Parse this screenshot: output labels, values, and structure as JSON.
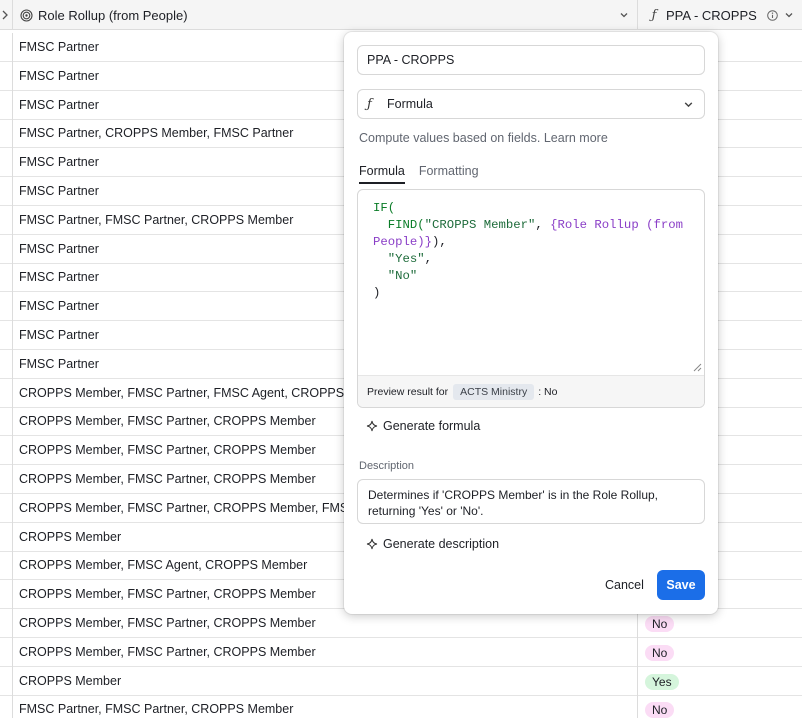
{
  "grid": {
    "columns": [
      {
        "label": "Role Rollup (from People)",
        "icon": "rollup-icon"
      },
      {
        "label": "PPA - CROPPS",
        "icon": "formula-icon"
      }
    ],
    "rows": [
      {
        "role": "FMSC Partner",
        "ppa": ""
      },
      {
        "role": "FMSC Partner",
        "ppa": ""
      },
      {
        "role": "FMSC Partner",
        "ppa": ""
      },
      {
        "role": "FMSC Partner, CROPPS Member, FMSC Partner",
        "ppa": ""
      },
      {
        "role": "FMSC Partner",
        "ppa": ""
      },
      {
        "role": "FMSC Partner",
        "ppa": ""
      },
      {
        "role": "FMSC Partner, FMSC Partner, CROPPS Member",
        "ppa": ""
      },
      {
        "role": "FMSC Partner",
        "ppa": ""
      },
      {
        "role": "FMSC Partner",
        "ppa": ""
      },
      {
        "role": "FMSC Partner",
        "ppa": ""
      },
      {
        "role": "FMSC Partner",
        "ppa": ""
      },
      {
        "role": "FMSC Partner",
        "ppa": ""
      },
      {
        "role": "CROPPS Member, FMSC Partner, FMSC Agent, CROPPS Member",
        "ppa": ""
      },
      {
        "role": "CROPPS Member, FMSC Partner, CROPPS Member",
        "ppa": ""
      },
      {
        "role": "CROPPS Member, FMSC Partner, CROPPS Member",
        "ppa": ""
      },
      {
        "role": "CROPPS Member, FMSC Partner, CROPPS Member",
        "ppa": ""
      },
      {
        "role": "CROPPS Member, FMSC Partner, CROPPS Member, FMSC Agent",
        "ppa": ""
      },
      {
        "role": "CROPPS Member",
        "ppa": ""
      },
      {
        "role": "CROPPS Member, FMSC Agent, CROPPS Member",
        "ppa": ""
      },
      {
        "role": "CROPPS Member, FMSC Partner, CROPPS Member",
        "ppa": ""
      },
      {
        "role": "CROPPS Member, FMSC Partner, CROPPS Member",
        "ppa": "No"
      },
      {
        "role": "CROPPS Member, FMSC Partner, CROPPS Member",
        "ppa": "No"
      },
      {
        "role": "CROPPS Member",
        "ppa": "Yes"
      },
      {
        "role": "FMSC Partner, FMSC Partner, CROPPS Member",
        "ppa": "No"
      }
    ]
  },
  "popover": {
    "field_name": "PPA - CROPPS",
    "field_type": "Formula",
    "helper_text": "Compute values based on fields.",
    "learn_more": "Learn more",
    "tabs": [
      {
        "label": "Formula",
        "active": true
      },
      {
        "label": "Formatting",
        "active": false
      }
    ],
    "formula": {
      "line1_fn": "IF(",
      "line2_fn": "FIND(",
      "line2_str": "\"CROPPS Member\"",
      "line2_comma": ", ",
      "line2_field": "{Role Rollup (from",
      "line3_field": "People)}",
      "line3_punc": "),",
      "line4_str": "\"Yes\"",
      "line4_punc": ",",
      "line5_str": "\"No\"",
      "line6_punc": ")"
    },
    "preview": {
      "prefix": "Preview result for",
      "record": "ACTS Ministry",
      "result": ": No"
    },
    "generate_formula_label": "Generate formula",
    "description_label": "Description",
    "description_text": "Determines if 'CROPPS Member' is in the Role Rollup, returning 'Yes' or 'No'.",
    "generate_description_label": "Generate description",
    "cancel_label": "Cancel",
    "save_label": "Save"
  },
  "colors": {
    "save_button": "#1b6ee8",
    "pill_no": "#fbdcf5",
    "pill_yes": "#d5f5dc",
    "formula_function": "#0b7d28",
    "formula_field": "#8a3ec7"
  }
}
